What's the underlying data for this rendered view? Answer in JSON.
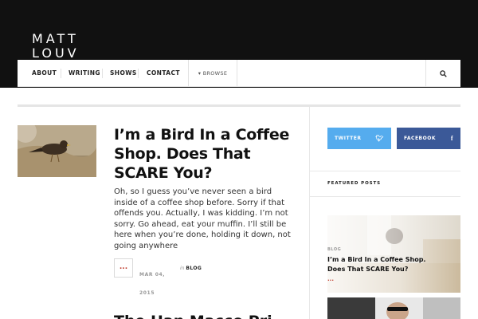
{
  "site": {
    "logo": "MATT\nLOUV"
  },
  "nav": {
    "items": [
      {
        "id": "about",
        "label": "ABOUT"
      },
      {
        "id": "writing",
        "label": "WRITING"
      },
      {
        "id": "shows",
        "label": "SHOWS"
      },
      {
        "id": "contact",
        "label": "CONTACT"
      }
    ],
    "browse_label": "BROWSE",
    "icons": {
      "browse": "caret-down-icon",
      "search": "search-icon"
    }
  },
  "post": {
    "title": "I’m a Bird In a Coffee Shop. Does That SCARE You?",
    "excerpt": "Oh, so I guess you’ve never seen a bird inside of a coffee shop before. Sorry if that offends you. Actually, I was kidding. I’m not sorry. Go ahead, eat your muffin. I’ll still be here when you’re done, holding it down, not going anywhere",
    "more_label": "...",
    "date": "MAR 04, 2015",
    "category_prefix": "in",
    "category": "BLOG"
  },
  "post2": {
    "title": "The Han Macco Pri"
  },
  "sidebar": {
    "social": [
      {
        "id": "twitter",
        "label": "TWITTER",
        "icon": "twitter-icon",
        "color": "#55acee"
      },
      {
        "id": "facebook",
        "label": "FACEBOOK",
        "icon": "facebook-icon",
        "color": "#3b5998"
      }
    ],
    "featured_heading": "FEATURED POSTS",
    "featured": [
      {
        "category": "BLOG",
        "title": "I’m a Bird In a Coffee Shop. Does That SCARE You?",
        "more": "..."
      }
    ]
  },
  "colors": {
    "header_bg": "#111111",
    "accent": "#c0392b"
  }
}
